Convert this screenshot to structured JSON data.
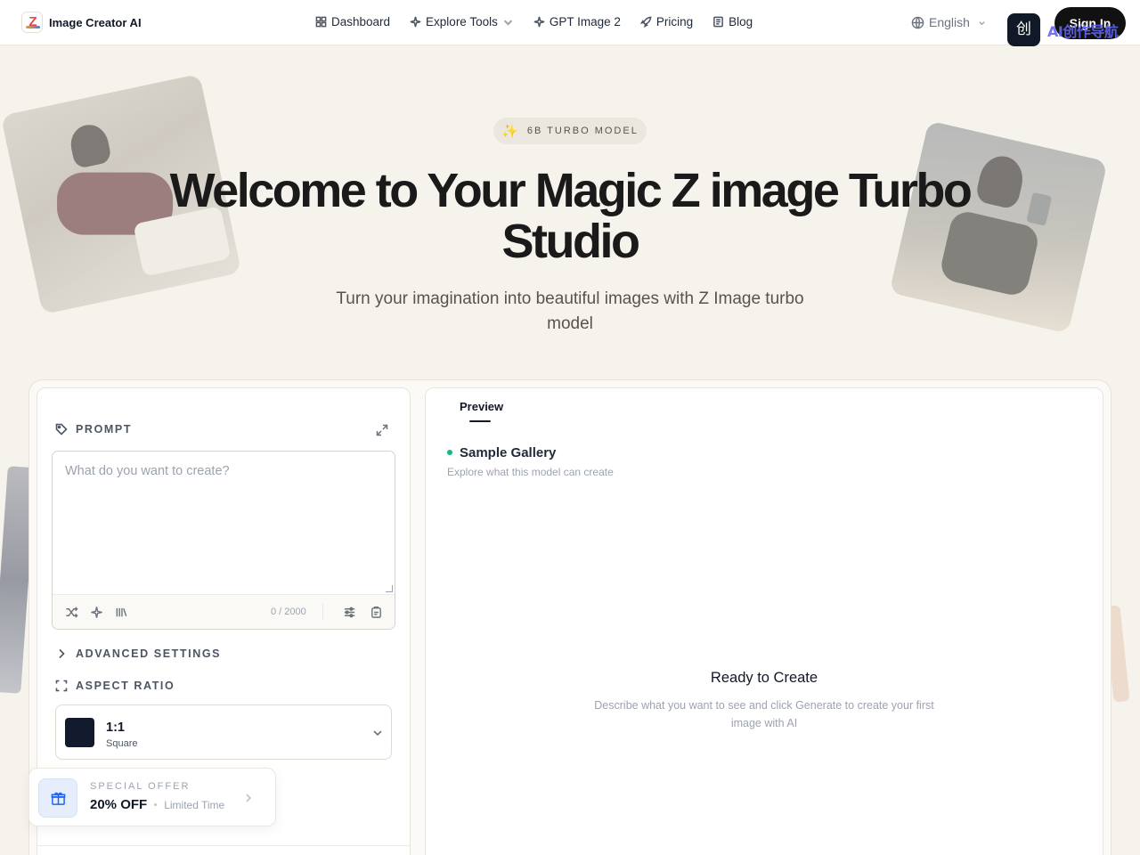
{
  "brand": {
    "name": "Image Creator AI",
    "logo_letter": "Z"
  },
  "nav": {
    "dashboard": "Dashboard",
    "explore_tools": "Explore Tools",
    "gpt_image": "GPT Image 2",
    "pricing": "Pricing",
    "blog": "Blog"
  },
  "language": "English",
  "sign_in": "Sign In",
  "extension": {
    "icon_glyph": "创",
    "overlay_text": "AI创作导航"
  },
  "hero": {
    "badge_icon": "✨",
    "badge_text": "6B TURBO MODEL",
    "title": "Welcome to Your Magic Z image Turbo Studio",
    "subtitle": "Turn your imagination into beautiful images with Z Image turbo model"
  },
  "prompt": {
    "label": "PROMPT",
    "placeholder": "What do you want to create?",
    "value": "",
    "counter": "0 / 2000"
  },
  "advanced_settings": {
    "label": "ADVANCED SETTINGS"
  },
  "aspect_ratio": {
    "label": "ASPECT RATIO",
    "value": "1:1",
    "description": "Square",
    "swatch_color": "#141a2e"
  },
  "offer": {
    "kicker": "SPECIAL OFFER",
    "value": "20% OFF",
    "note": "Limited Time"
  },
  "preview": {
    "tab": "Preview",
    "gallery_title": "Sample Gallery",
    "gallery_subtitle": "Explore what this model can create",
    "empty_title": "Ready to Create",
    "empty_text": "Describe what you want to see and click Generate to create your first image with AI"
  },
  "colors": {
    "background": "#f6f3ec",
    "accent_dark": "#111111",
    "status_green": "#10b981",
    "offer_blue": "#2563eb"
  },
  "icons": [
    "layout-grid-icon",
    "sparkles-icon",
    "rocket-icon",
    "newspaper-icon",
    "globe-icon",
    "tag-icon",
    "expand-icon",
    "shuffle-icon",
    "magic-wand-icon",
    "library-icon",
    "sliders-icon",
    "clipboard-icon",
    "chevron-right-icon",
    "crop-frame-icon",
    "chevron-down-icon",
    "gift-icon"
  ]
}
